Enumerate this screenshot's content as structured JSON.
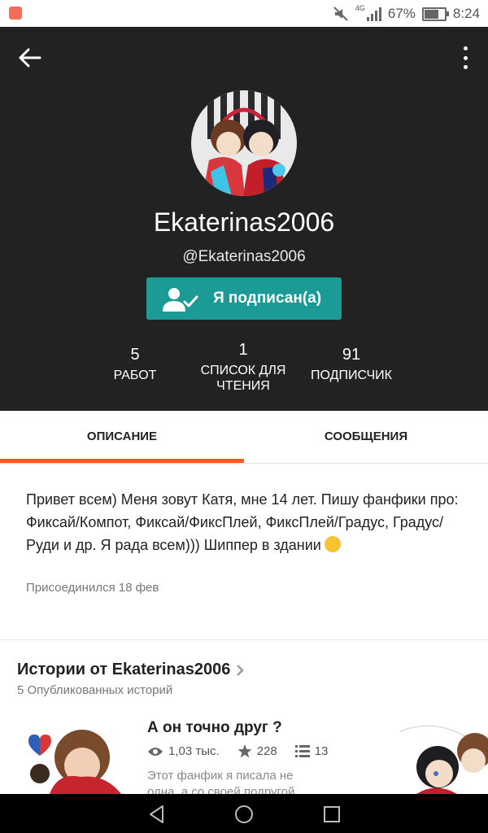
{
  "status_bar": {
    "network": "4G",
    "battery": "67%",
    "time": "8:24"
  },
  "profile": {
    "name": "Ekaterinas2006",
    "handle": "@Ekaterinas2006",
    "follow_label": "Я подписан(а)",
    "stats": [
      {
        "value": "5",
        "label": "РАБОТ"
      },
      {
        "value": "1",
        "label": "СПИСОК ДЛЯ ЧТЕНИЯ"
      },
      {
        "value": "91",
        "label": "ПОДПИСЧИК"
      }
    ]
  },
  "tabs": [
    {
      "label": "ОПИСАНИЕ",
      "active": true
    },
    {
      "label": "СООБЩЕНИЯ",
      "active": false
    }
  ],
  "description": {
    "text": "Привет всем) Меня зовут Катя, мне 14 лет. Пишу фанфики про: Фиксай/Компот, Фиксай/ФиксПлей, ФиксПлей/Градус, Градус/ Руди и др. Я рада всем))) Шиппер в здании",
    "joined": "Присоединился 18 фев"
  },
  "stories": {
    "title": "Истории от Ekaterinas2006",
    "subtitle": "5 Опубликованных историй",
    "items": [
      {
        "title": "А он точно друг ?",
        "reads": "1,03 тыс.",
        "votes": "228",
        "parts": "13",
        "excerpt": "Этот фанфик я писала не одна, а со своей подругой"
      }
    ]
  },
  "colors": {
    "header_bg": "#222222",
    "accent_teal": "#1b9a96",
    "tab_indicator": "#ff5a1f"
  }
}
